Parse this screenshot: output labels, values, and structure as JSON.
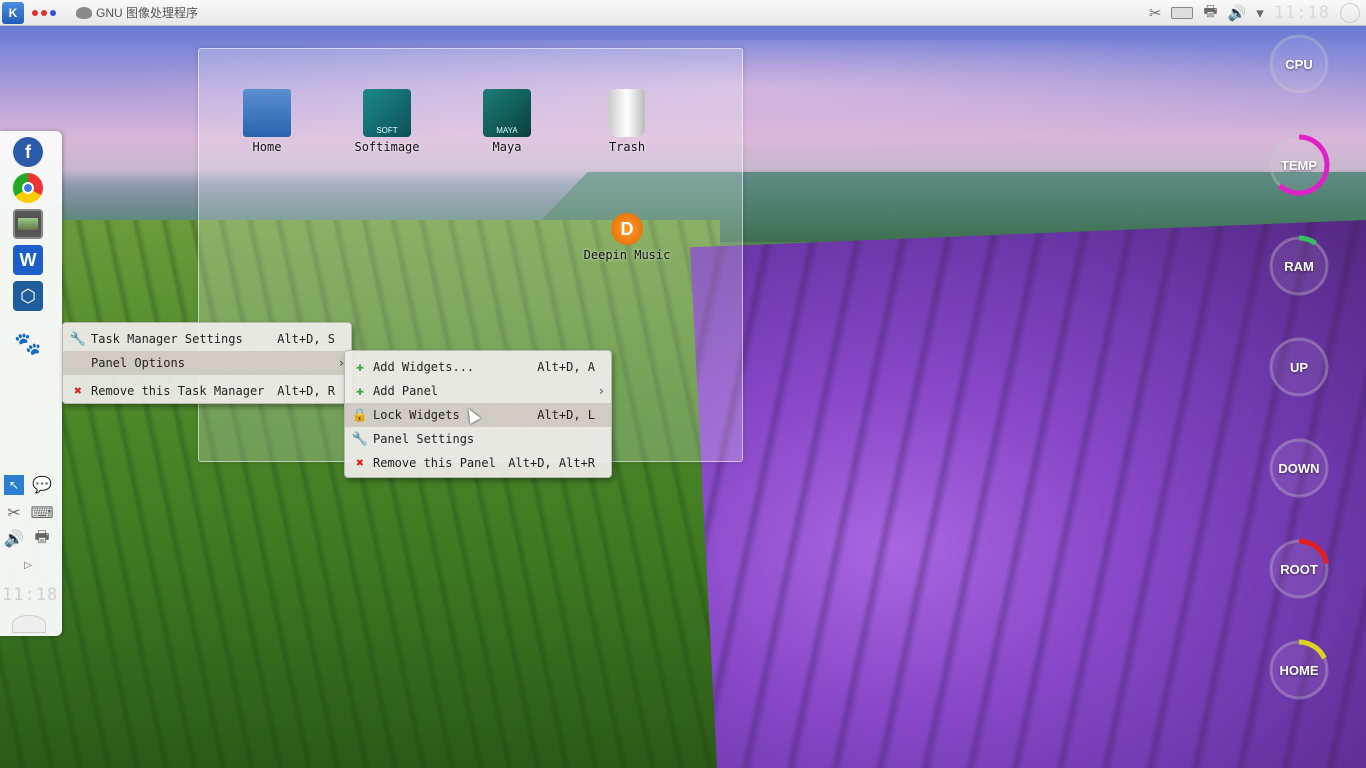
{
  "topbar": {
    "launcher_icon": "kde-k-icon",
    "window_title": "GNU 图像处理程序",
    "clock": "11:18",
    "tray_icons": [
      "scissors-icon",
      "keyboard-icon",
      "printer-icon",
      "volume-icon",
      "chevron-down-icon"
    ]
  },
  "leftpanel": {
    "apps": [
      "fedora-icon",
      "chrome-icon",
      "image-viewer-icon",
      "wps-writer-icon",
      "virtualbox-icon",
      "gimp-icon"
    ],
    "clock": "11:18"
  },
  "desktop": {
    "icons": [
      {
        "label": "Home"
      },
      {
        "label": "Softimage"
      },
      {
        "label": "Maya"
      },
      {
        "label": "Trash"
      },
      {
        "label": "Deepin Music"
      }
    ],
    "softimage_badge": "SOFT",
    "maya_badge": "MAYA"
  },
  "context_menu": {
    "items": [
      {
        "label": "Task Manager Settings",
        "shortcut": "Alt+D, S"
      },
      {
        "label": "Panel Options",
        "shortcut": ""
      },
      {
        "label": "Remove this Task Manager",
        "shortcut": "Alt+D, R"
      }
    ]
  },
  "submenu": {
    "items": [
      {
        "label": "Add Widgets...",
        "shortcut": "Alt+D, A"
      },
      {
        "label": "Add Panel",
        "shortcut": ""
      },
      {
        "label": "Lock Widgets",
        "shortcut": "Alt+D, L"
      },
      {
        "label": "Panel Settings",
        "shortcut": ""
      },
      {
        "label": "Remove this Panel",
        "shortcut": "Alt+D, Alt+R"
      }
    ]
  },
  "gauges": [
    {
      "label": "CPU",
      "color": "#5aa0ff",
      "fraction": 0.0
    },
    {
      "label": "TEMP",
      "color": "#e020c8",
      "fraction": 0.62
    },
    {
      "label": "RAM",
      "color": "#33c060",
      "fraction": 0.1
    },
    {
      "label": "UP",
      "color": "#999999",
      "fraction": 0.0
    },
    {
      "label": "DOWN",
      "color": "#999999",
      "fraction": 0.0
    },
    {
      "label": "ROOT",
      "color": "#e02020",
      "fraction": 0.22
    },
    {
      "label": "HOME",
      "color": "#e0d020",
      "fraction": 0.18
    }
  ]
}
